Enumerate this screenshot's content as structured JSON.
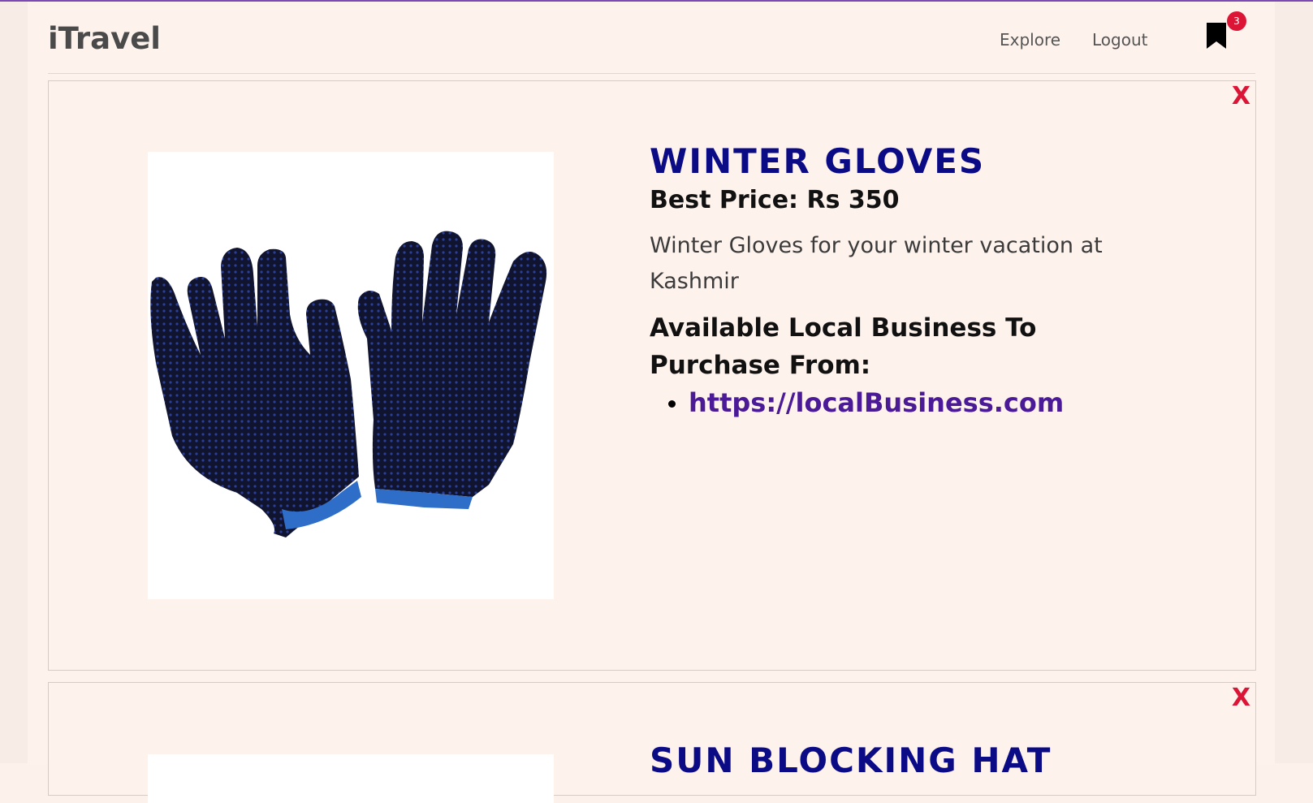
{
  "navbar": {
    "brand": "iTravel",
    "links": [
      "Explore",
      "Logout"
    ],
    "bookmark_count": "3",
    "bookmark_icon": "bookmark-icon"
  },
  "cards": [
    {
      "close_label": "X",
      "title": "WINTER GLOVES",
      "price": "Best Price: Rs 350",
      "description": "Winter Gloves for your winter vacation at Kashmir",
      "available_heading": "Available Local Business To Purchase From:",
      "links": [
        "https://localBusiness.com"
      ],
      "image_icon": "gloves-image"
    },
    {
      "close_label": "X",
      "title": "SUN BLOCKING HAT"
    }
  ],
  "colors": {
    "title": "#0b0b85",
    "close": "#dc1435",
    "link": "#4b1a96",
    "badge": "#dc1435",
    "background": "#fef2ec"
  }
}
